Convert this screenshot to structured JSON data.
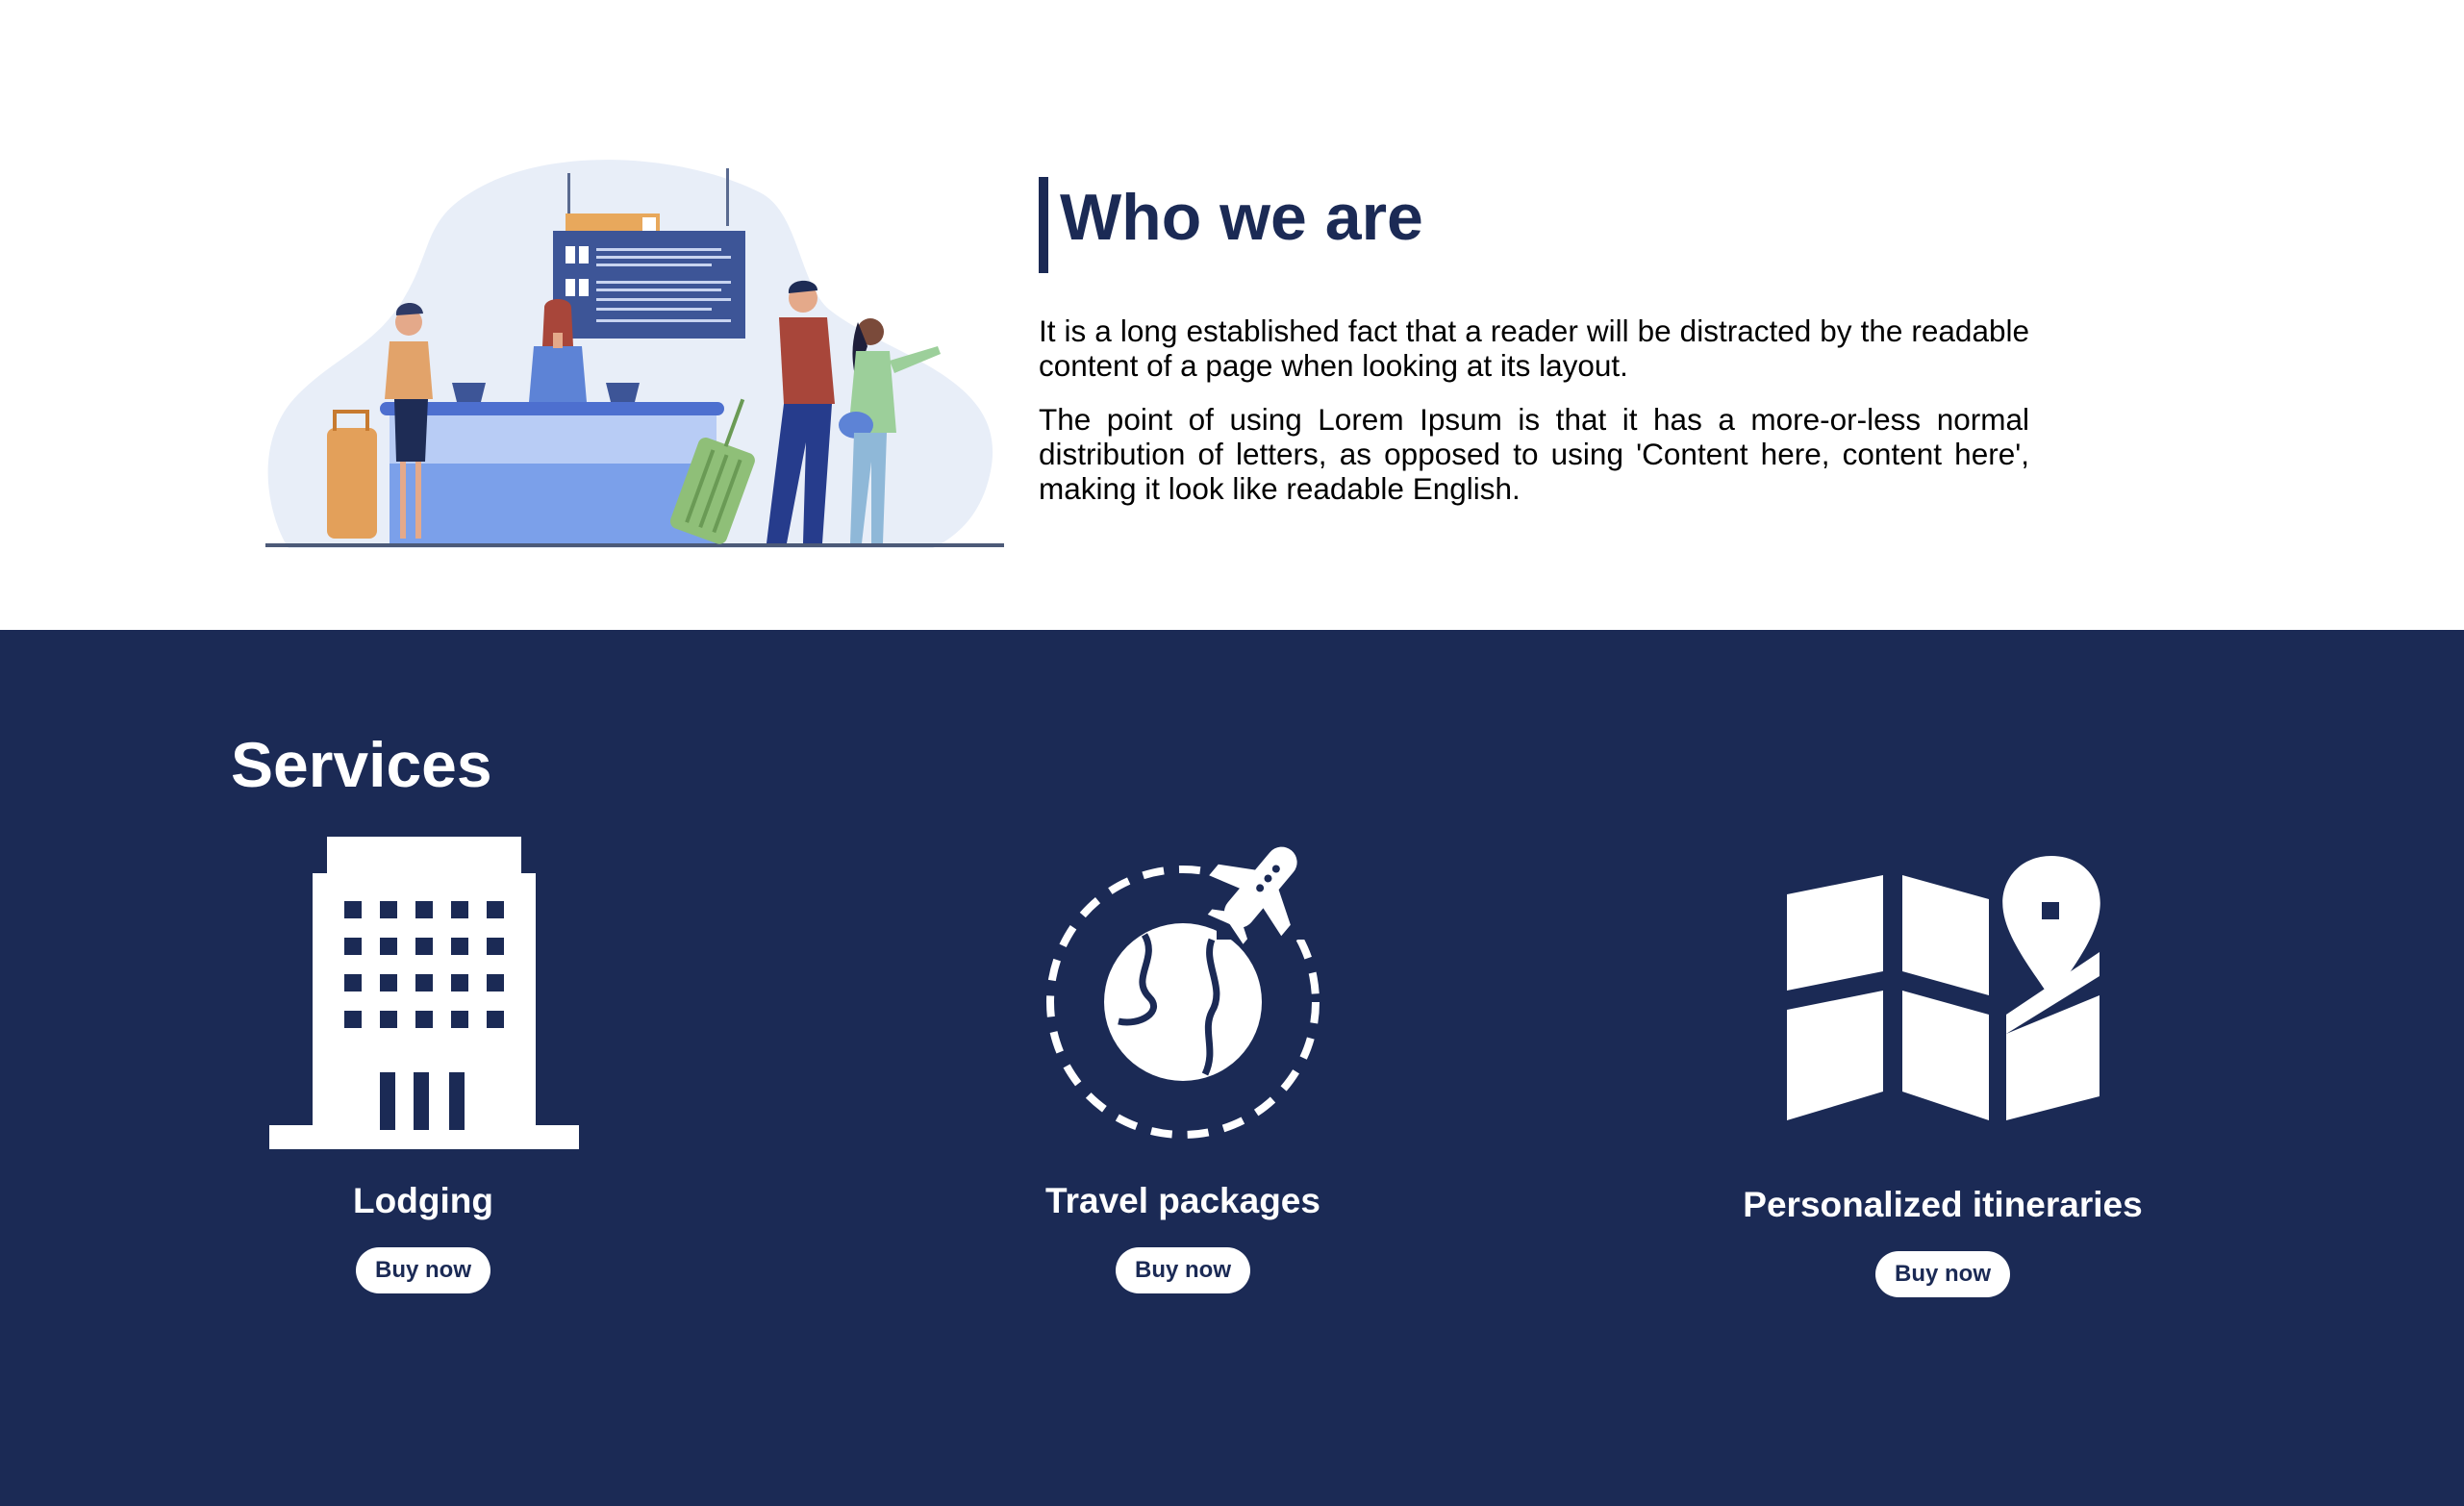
{
  "about": {
    "title": "Who we are",
    "paragraphs": [
      "It is a long established fact that a reader will be distracted by the readable content of a page when looking at its layout.",
      "The point of using Lorem Ipsum is that it has a more-or-less normal distribution of letters, as opposed to using 'Content here, content here', making it look like readable English."
    ],
    "illustration": "airport-check-in-illustration"
  },
  "services": {
    "title": "Services",
    "items": [
      {
        "name": "Lodging",
        "button": "Buy now",
        "icon": "hotel-building-icon"
      },
      {
        "name": "Travel packages",
        "button": "Buy now",
        "icon": "globe-airplane-icon"
      },
      {
        "name": "Personalized itineraries",
        "button": "Buy now",
        "icon": "map-pin-icon"
      }
    ]
  },
  "colors": {
    "navy": "#1b2a55",
    "white": "#ffffff",
    "light_blue": "#e8eef8"
  }
}
